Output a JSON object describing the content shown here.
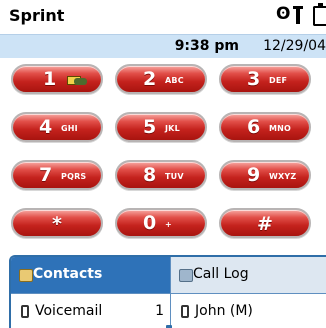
{
  "status_bar": {
    "carrier": "Sprint",
    "bluetooth_icon": "bluetooth-icon",
    "bluetooth_glyph": "ʘ",
    "signal_icon": "signal-icon",
    "battery_icon": "battery-icon"
  },
  "datetime": {
    "time": "9:38 pm",
    "date": "12/29/04"
  },
  "keypad": {
    "keys": [
      {
        "digit": "1",
        "letters": "",
        "icon": "voicemail-icon"
      },
      {
        "digit": "2",
        "letters": "ABC"
      },
      {
        "digit": "3",
        "letters": "DEF"
      },
      {
        "digit": "4",
        "letters": "GHI"
      },
      {
        "digit": "5",
        "letters": "JKL"
      },
      {
        "digit": "6",
        "letters": "MNO"
      },
      {
        "digit": "7",
        "letters": "PQRS"
      },
      {
        "digit": "8",
        "letters": "TUV"
      },
      {
        "digit": "9",
        "letters": "WXYZ"
      },
      {
        "digit": "*",
        "letters": ""
      },
      {
        "digit": "0",
        "letters": "+"
      },
      {
        "digit": "#",
        "letters": ""
      }
    ],
    "colors": {
      "key_top": "#f7a8a3",
      "key_mid": "#e2504a",
      "key_bottom": "#a8140f",
      "key_border": "#b8b4b4"
    }
  },
  "tabs": {
    "contacts_label": "Contacts",
    "contacts_icon": "contacts-icon",
    "calllog_label": "Call Log",
    "calllog_icon": "call-log-icon",
    "active": "Contacts",
    "colors": {
      "active": "#2e72b8",
      "inactive": "#dde7f1"
    }
  },
  "speed_dial": {
    "voicemail_label": "Voicemail",
    "voicemail_number": "1",
    "contact_label": "John (M)",
    "icon": "phone-icon"
  },
  "colors": {
    "datetime_bar": "#cde3f6",
    "accent_blue": "#2f6ea8"
  }
}
